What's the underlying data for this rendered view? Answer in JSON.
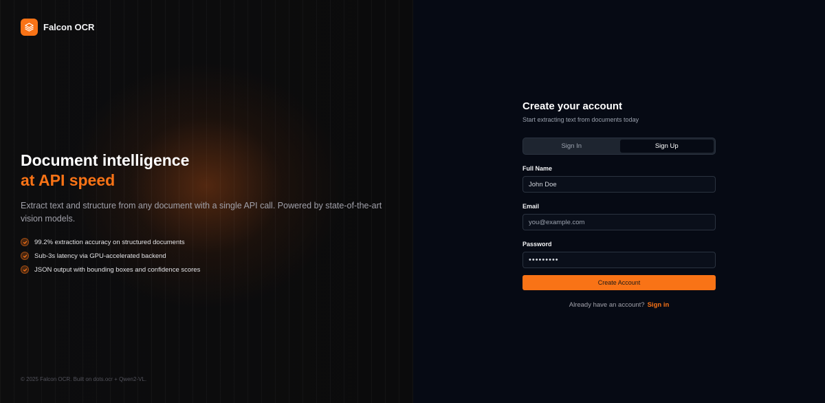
{
  "brand": {
    "name": "Falcon OCR",
    "logo_icon": "layers-icon",
    "accent_color": "#f97316"
  },
  "hero": {
    "title_line1": "Document intelligence",
    "title_line2": "at API speed",
    "description": "Extract text and structure from any document with a single API call. Powered by state-of-the-art vision models.",
    "features": [
      "99.2% extraction accuracy on structured documents",
      "Sub-3s latency via GPU-accelerated backend",
      "JSON output with bounding boxes and confidence scores"
    ]
  },
  "footer": {
    "text": "© 2025 Falcon OCR. Built on dots.ocr + Qwen2-VL."
  },
  "form": {
    "title": "Create your account",
    "subtitle": "Start extracting text from documents today",
    "tabs": [
      {
        "label": "Sign In",
        "active": false
      },
      {
        "label": "Sign Up",
        "active": true
      }
    ],
    "fields": {
      "full_name": {
        "label": "Full Name",
        "value": "John Doe"
      },
      "email": {
        "label": "Email",
        "placeholder": "you@example.com"
      },
      "password": {
        "label": "Password",
        "value": "•••••••••"
      }
    },
    "submit_label": "Create Account",
    "switch_prompt": "Already have an account?",
    "switch_link": "Sign in"
  }
}
